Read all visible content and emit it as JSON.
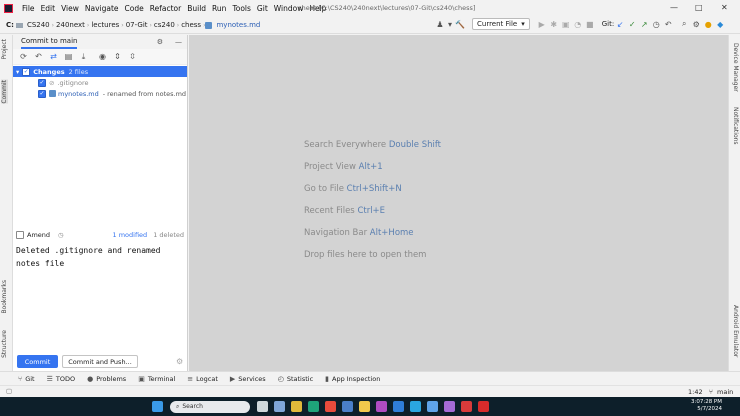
{
  "window": {
    "title": "chess [C:\\CS240\\240next\\lectures\\07-Git\\cs240\\chess]",
    "controls": [
      "—",
      "□",
      "✕"
    ]
  },
  "menu": [
    "File",
    "Edit",
    "View",
    "Navigate",
    "Code",
    "Refactor",
    "Build",
    "Run",
    "Tools",
    "Git",
    "Window",
    "Help"
  ],
  "breadcrumb": [
    "C:",
    "CS240",
    "240next",
    "lectures",
    "07-Git",
    "cs240",
    "chess",
    "mynotes.md"
  ],
  "toolbar": {
    "run_config": "Current File",
    "git_label": "Git:"
  },
  "left_tabs": [
    "Project",
    "Commit",
    "Bookmarks",
    "Structure"
  ],
  "right_tabs": [
    "Device Manager",
    "Notifications",
    "Android Emulator"
  ],
  "commit_panel": {
    "tab": "Commit to main",
    "changes_label": "Changes",
    "changes_count": "2 files",
    "files": [
      {
        "name": ".gitignore",
        "note": ""
      },
      {
        "name": "mynotes.md",
        "note": "- renamed from notes.md"
      }
    ],
    "amend_label": "Amend",
    "modified_summary": "1 modified",
    "deleted_summary": "1 deleted",
    "message_line1": "Deleted .gitignore and renamed",
    "message_line2": "notes file",
    "commit_button": "Commit",
    "commit_push_button": "Commit and Push..."
  },
  "editor_hints": [
    {
      "text": "Search Everywhere",
      "key": "Double Shift"
    },
    {
      "text": "Project View",
      "key": "Alt+1"
    },
    {
      "text": "Go to File",
      "key": "Ctrl+Shift+N"
    },
    {
      "text": "Recent Files",
      "key": "Ctrl+E"
    },
    {
      "text": "Navigation Bar",
      "key": "Alt+Home"
    },
    {
      "text": "Drop files here to open them",
      "key": ""
    }
  ],
  "bottom_tools": [
    "Git",
    "TODO",
    "Problems",
    "Terminal",
    "Logcat",
    "Services",
    "Statistic",
    "App Inspection"
  ],
  "status": {
    "position": "1:42",
    "branch": "main"
  },
  "taskbar": {
    "search_placeholder": "Search",
    "time": "3:07:28 PM",
    "date": "5/7/2024"
  },
  "colors": {
    "accent": "#3574f0",
    "editor_bg": "#d3d3d3"
  }
}
